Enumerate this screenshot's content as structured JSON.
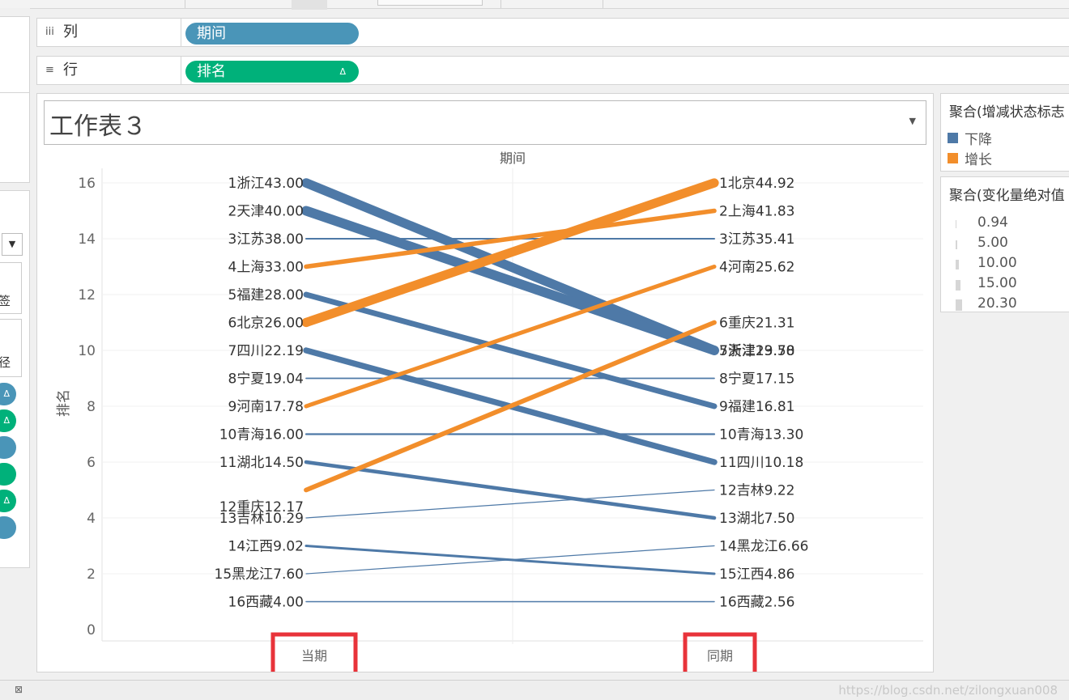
{
  "rows_shelf": {
    "columns_label": "列",
    "columns_pill": "期间",
    "rows_label": "行",
    "rows_pill": "排名",
    "rows_pill_marker": "Δ"
  },
  "worksheet": {
    "title": "工作表３",
    "column_header": "期间"
  },
  "left_panel": {
    "label_a": "签",
    "label_b": "径"
  },
  "legend_color": {
    "title": "聚合(增减状态标志",
    "items": [
      {
        "label": "下降",
        "color": "#4e79a7"
      },
      {
        "label": "增长",
        "color": "#f28e2b"
      }
    ]
  },
  "legend_size": {
    "title": "聚合(变化量绝对值",
    "items": [
      "0.94",
      "5.00",
      "10.00",
      "15.00",
      "20.30"
    ]
  },
  "chart_data": {
    "type": "line",
    "ylabel": "排名",
    "ylim": [
      0,
      16
    ],
    "yticks": [
      0,
      2,
      4,
      6,
      8,
      10,
      12,
      14,
      16
    ],
    "categories": [
      "当期",
      "同期"
    ],
    "grid": true,
    "series": [
      {
        "rank_current": 16,
        "rank_previous": 10,
        "left_label": "1浙江43.00",
        "right_label": "5浙江23.58",
        "status": "下降",
        "abs_change": 19.42
      },
      {
        "rank_current": 15,
        "rank_previous": 10,
        "left_label": "2天津40.00",
        "right_label": "7天津19.70",
        "status": "下降",
        "abs_change": 20.3
      },
      {
        "rank_current": 14,
        "rank_previous": 14,
        "left_label": "3江苏38.00",
        "right_label": "3江苏35.41",
        "status": "下降",
        "abs_change": 2.59
      },
      {
        "rank_current": 13,
        "rank_previous": 15,
        "left_label": "4上海33.00",
        "right_label": "2上海41.83",
        "status": "增长",
        "abs_change": 8.83
      },
      {
        "rank_current": 12,
        "rank_previous": 8,
        "left_label": "5福建28.00",
        "right_label": "9福建16.81",
        "status": "下降",
        "abs_change": 11.19
      },
      {
        "rank_current": 11,
        "rank_previous": 16,
        "left_label": "6北京26.00",
        "right_label": "1北京44.92",
        "status": "增长",
        "abs_change": 18.92
      },
      {
        "rank_current": 10,
        "rank_previous": 6,
        "left_label": "7四川22.19",
        "right_label": "11四川10.18",
        "status": "下降",
        "abs_change": 12.01
      },
      {
        "rank_current": 9,
        "rank_previous": 9,
        "left_label": "8宁夏19.04",
        "right_label": "8宁夏17.15",
        "status": "下降",
        "abs_change": 1.89
      },
      {
        "rank_current": 8,
        "rank_previous": 13,
        "left_label": "9河南17.78",
        "right_label": "4河南25.62",
        "status": "增长",
        "abs_change": 7.84
      },
      {
        "rank_current": 7,
        "rank_previous": 7,
        "left_label": "10青海16.00",
        "right_label": "10青海13.30",
        "status": "下降",
        "abs_change": 2.7
      },
      {
        "rank_current": 6,
        "rank_previous": 4,
        "left_label": "11湖北14.50",
        "right_label": "13湖北7.50",
        "status": "下降",
        "abs_change": 7.0
      },
      {
        "rank_current": 5,
        "rank_previous": 11,
        "left_label": "12重庆12.17",
        "right_label": "6重庆21.31",
        "status": "增长",
        "abs_change": 9.14
      },
      {
        "rank_current": 4,
        "rank_previous": 5,
        "left_label": "13吉林10.29",
        "right_label": "12吉林9.22",
        "status": "下降",
        "abs_change": 1.07
      },
      {
        "rank_current": 3,
        "rank_previous": 2,
        "left_label": "14江西9.02",
        "right_label": "15江西4.86",
        "status": "下降",
        "abs_change": 4.16
      },
      {
        "rank_current": 2,
        "rank_previous": 3,
        "left_label": "15黑龙江7.60",
        "right_label": "14黑龙江6.66",
        "status": "下降",
        "abs_change": 0.94
      },
      {
        "rank_current": 1,
        "rank_previous": 1,
        "left_label": "16西藏4.00",
        "right_label": "16西藏2.56",
        "status": "下降",
        "abs_change": 1.44
      }
    ]
  },
  "watermark": "https://blog.csdn.net/zilongxuan008"
}
